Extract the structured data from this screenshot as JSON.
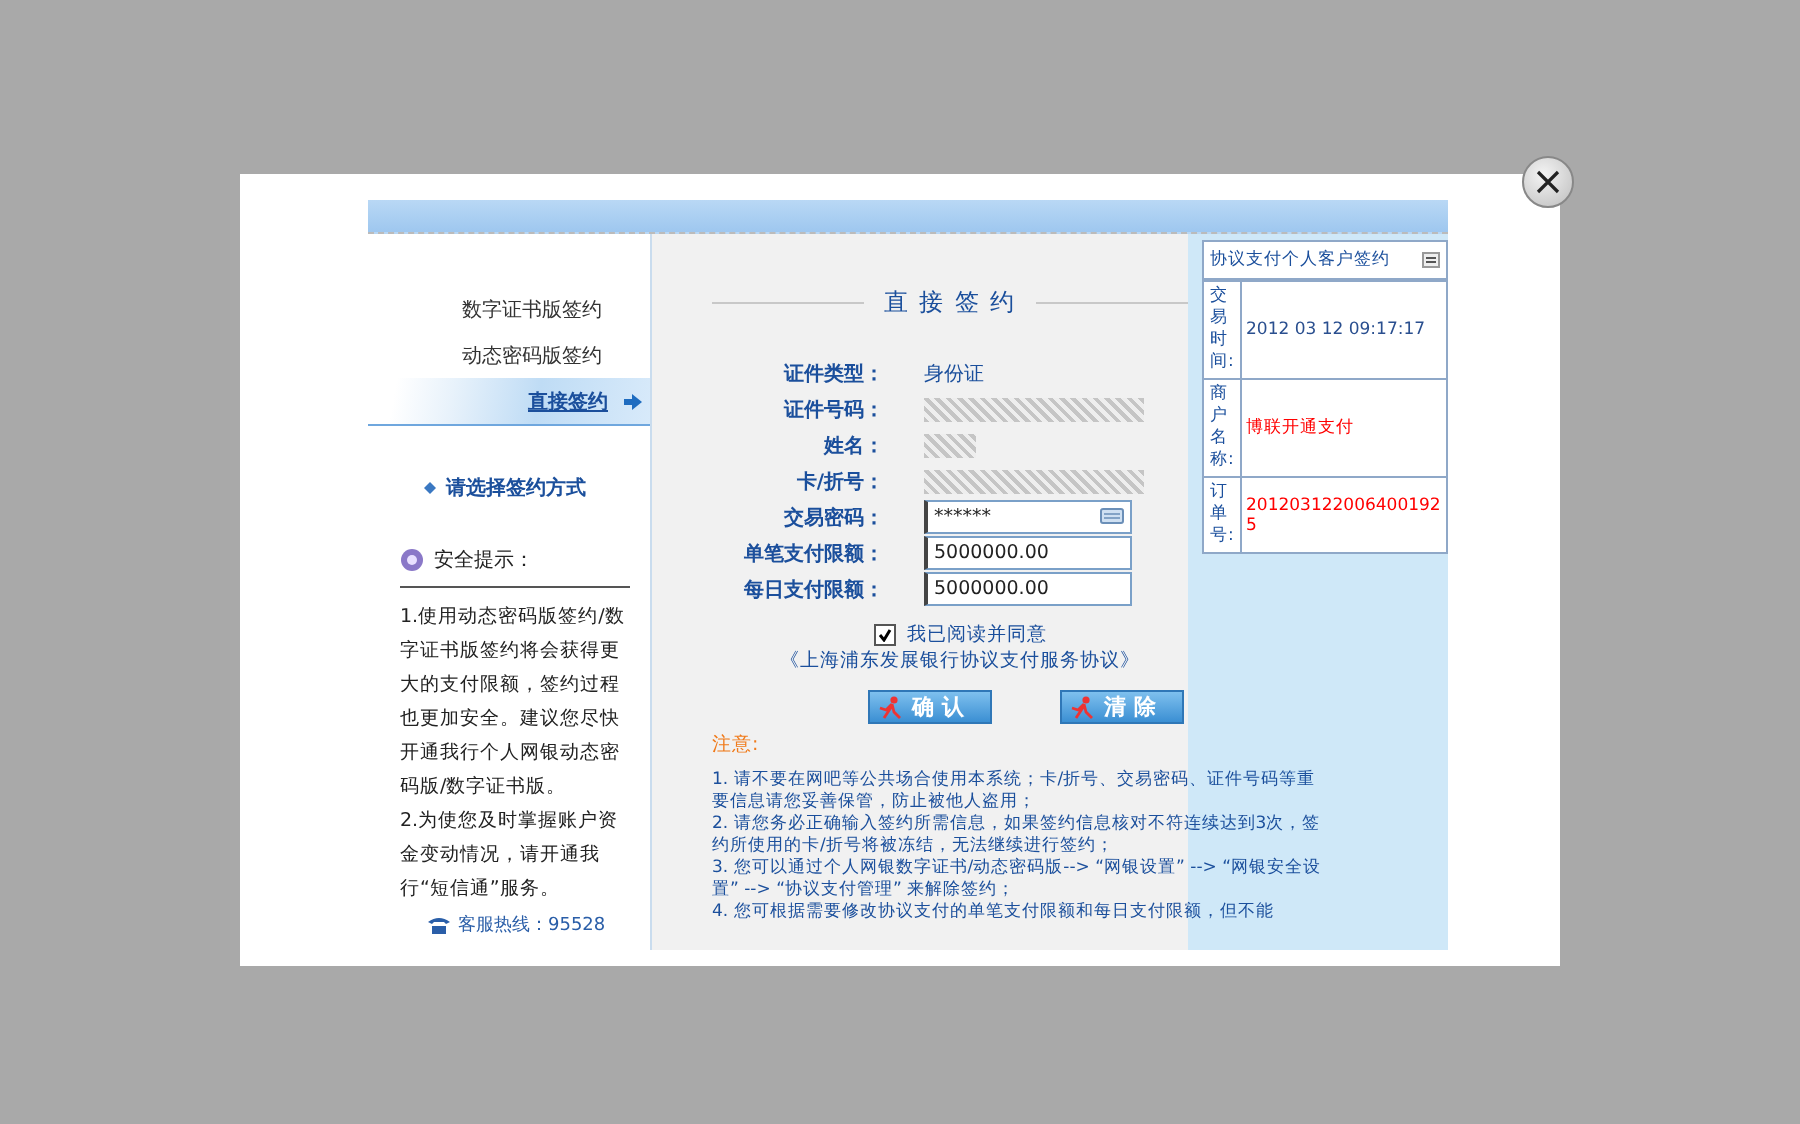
{
  "menu": [
    {
      "label": "数字证书版签约",
      "selected": false
    },
    {
      "label": "动态密码版签约",
      "selected": false
    },
    {
      "label": "直接签约",
      "selected": true
    }
  ],
  "choose_hint": "请选择签约方式",
  "security": {
    "title": "安全提示：",
    "paragraphs": [
      "1.使用动态密码版签约/数字证书版签约将会获得更大的支付限额，签约过程也更加安全。建议您尽快开通我行个人网银动态密码版/数字证书版。",
      "2.为使您及时掌握账户资金变动情况，请开通我行“短信通”服务。"
    ]
  },
  "hotline": "客服热线：95528",
  "form": {
    "title": "直 接 签 约",
    "rows": [
      {
        "kind": "text",
        "label": "证件类型：",
        "value": "身份证"
      },
      {
        "kind": "masked",
        "label": "证件号码："
      },
      {
        "kind": "masked_short",
        "label": "姓名："
      },
      {
        "kind": "masked",
        "label": "卡/折号："
      },
      {
        "kind": "password",
        "label": "交易密码：",
        "value": "******"
      },
      {
        "kind": "input",
        "label": "单笔支付限额：",
        "value": "5000000.00"
      },
      {
        "kind": "input",
        "label": "每日支付限额：",
        "value": "5000000.00"
      }
    ],
    "agree": {
      "checked": true,
      "label": "我已阅读并同意",
      "link": "《上海浦东发展银行协议支付服务协议》"
    },
    "buttons": [
      "确 认",
      "清 除"
    ]
  },
  "notes": {
    "title": "注意:",
    "items": [
      "1. 请不要在网吧等公共场合使用本系统；卡/折号、交易密码、证件号码等重要信息请您妥善保管，防止被他人盗用；",
      "2. 请您务必正确输入签约所需信息，如果签约信息核对不符连续达到3次，签约所使用的卡/折号将被冻结，无法继续进行签约；",
      "3. 您可以通过个人网银数字证书/动态密码版--> “网银设置” --> “网银安全设置” --> “协议支付管理” 来解除签约；",
      "4. 您可根据需要修改协议支付的单笔支付限额和每日支付限额，但不能"
    ]
  },
  "order_panel": {
    "title": "协议支付个人客户签约",
    "rows": [
      {
        "label": "交易时间:",
        "value": "2012 03 12 09:17:17",
        "color": "#2a4f8f"
      },
      {
        "label": "商户名称:",
        "value": "博联开通支付",
        "color": "#ff0000"
      },
      {
        "label": "订单号:",
        "value": "2012031220064001925",
        "color": "#ff0000"
      }
    ]
  }
}
